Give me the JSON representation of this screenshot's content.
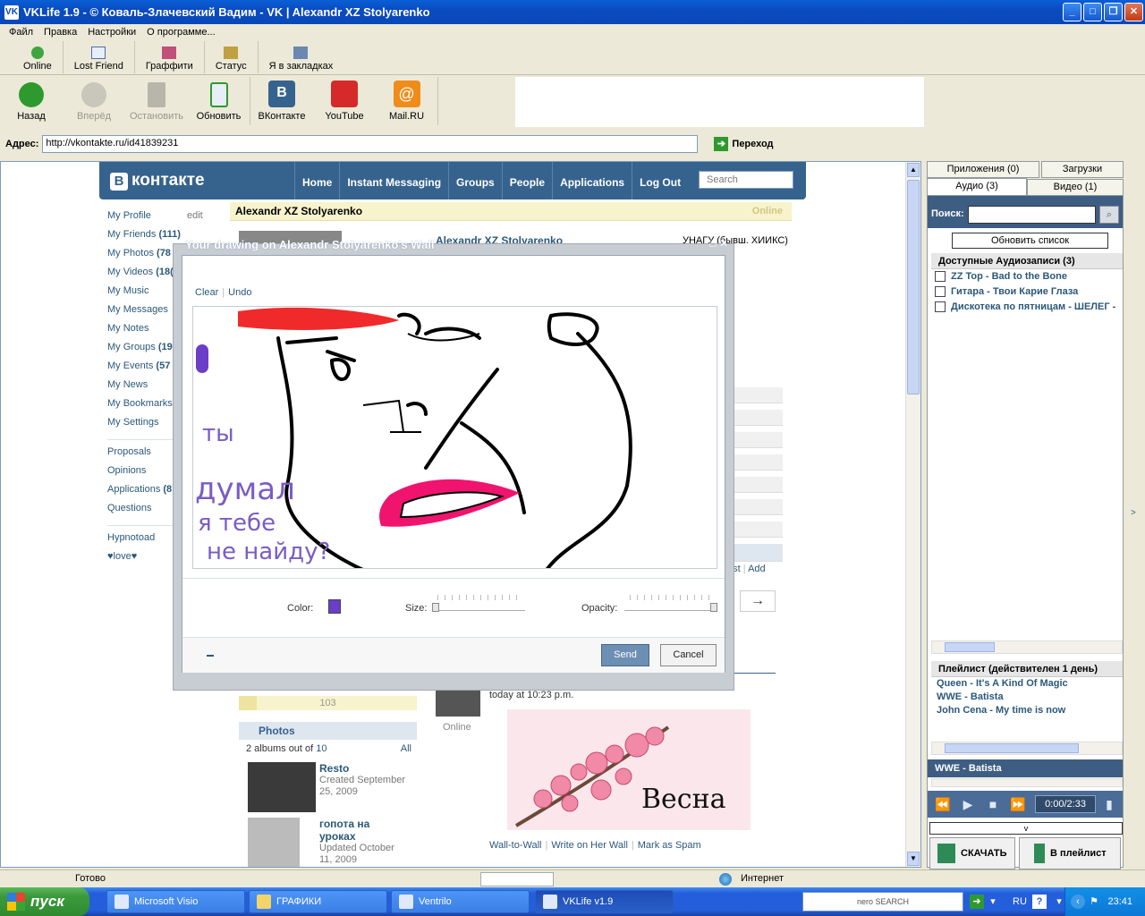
{
  "window": {
    "title": "VKLife 1.9 - © Коваль-Злачевский Вадим - VK | Alexandr XZ Stolyarenko",
    "app_icon": "vk-icon"
  },
  "menu": [
    "Файл",
    "Правка",
    "Настройки",
    "О программе..."
  ],
  "toolbar1": [
    {
      "label": "Online",
      "icon": "online-icon",
      "color": "#3fa63f"
    },
    {
      "label": "Lost Friend",
      "icon": "help-icon",
      "color": "#4c6fa8"
    },
    {
      "label": "Граффити",
      "icon": "paint-icon",
      "color": "#c0507a"
    },
    {
      "label": "Статус",
      "icon": "pencil-icon",
      "color": "#c0a040"
    },
    {
      "label": "Я в закладках",
      "icon": "bookmark-icon",
      "color": "#6a88b0"
    }
  ],
  "toolbar2": {
    "back": "Назад",
    "forward": "Вперёд",
    "stop": "Остановить",
    "refresh": "Обновить",
    "vk": "ВКонтакте",
    "youtube": "YouTube",
    "mail": "Mail.RU"
  },
  "address": {
    "label": "Адрес:",
    "url": "http://vkontakte.ru/id41839231",
    "go": "Переход"
  },
  "vk": {
    "logo": "контакте",
    "nav": [
      "Home",
      "Instant Messaging",
      "Groups",
      "People",
      "Applications",
      "Log Out"
    ],
    "search_placeholder": "Search",
    "menu": [
      {
        "t": "My Profile"
      },
      {
        "t": "My Friends",
        "c": "(111)"
      },
      {
        "t": "My Photos",
        "c": "(78"
      },
      {
        "t": "My Videos",
        "c": "(18("
      },
      {
        "t": "My Music"
      },
      {
        "t": "My Messages"
      },
      {
        "t": "My Notes"
      },
      {
        "t": "My Groups",
        "c": "(19"
      },
      {
        "t": "My Events",
        "c": "(57"
      },
      {
        "t": "My News"
      },
      {
        "t": "My Bookmarks"
      },
      {
        "t": "My Settings"
      }
    ],
    "edit": "edit",
    "menu2": [
      {
        "t": "Proposals"
      },
      {
        "t": "Opinions"
      },
      {
        "t": "Applications",
        "c": "(8"
      },
      {
        "t": "Questions"
      }
    ],
    "menu3": [
      "Hypnotoad",
      "♥love♥"
    ],
    "profile_name": "Alexandr XZ Stolyarenko",
    "status": "Online",
    "profile_link": "Alexandr XZ Stolyarenko",
    "university": "УНАГУ (бывш. ХИИКС)",
    "post_links": {
      "post": "ost",
      "add": "Add"
    },
    "pager_arrow": "→",
    "progress": {
      "value": "103",
      "fraction": 0.1
    },
    "photos": {
      "header": "Photos",
      "info": "2 albums out of",
      "count": "10",
      "all": "All",
      "albums": [
        {
          "name": "Resto",
          "desc": "Created September 25, 2009"
        },
        {
          "name": "гопота на уроках",
          "desc": "Updated October 11, 2009"
        }
      ]
    },
    "wall": {
      "time": "today at 10:23 p.m.",
      "online": "Online",
      "image_text": "Весна",
      "links": [
        "Wall-to-Wall",
        "Write on Her Wall",
        "Mark as Spam"
      ]
    }
  },
  "dialog": {
    "title": "Your drawing on Alexandr Stolyarenko's Wall",
    "clear": "Clear",
    "undo": "Undo",
    "canvas_text": [
      "ты",
      "думал",
      "я тебе",
      "не найду?"
    ],
    "color_label": "Color:",
    "color": "#6a3ec7",
    "size_label": "Size:",
    "size": 0,
    "opacity_label": "Opacity:",
    "opacity": 1,
    "send": "Send",
    "cancel": "Cancel"
  },
  "right": {
    "tabs_top": [
      "Приложения (0)",
      "Загрузки"
    ],
    "tabs": [
      "Аудио (3)",
      "Видео (1)"
    ],
    "search_label": "Поиск:",
    "refresh": "Обновить список",
    "audio_header": "Доступные Аудиозаписи (3)",
    "audio": [
      "ZZ Top  - Bad to the Bone",
      "Гитара  - Твои Карие Глаза",
      "Дискотека по пятницам - ШЕЛЕГ - :"
    ],
    "playlist_header": "Плейлист (действителен 1 день)",
    "playlist": [
      "Queen  - It's A Kind Of Magic",
      "WWE - Batista",
      "John Cena - My time is now"
    ],
    "now_playing": "WWE - Batista",
    "time": "0:00/2:33",
    "expand": "v",
    "download": "СКАЧАТЬ",
    "to_playlist": "В плейлист"
  },
  "statusbar": {
    "text": "Готово",
    "zone": "Интернет"
  },
  "taskbar": {
    "start": "пуск",
    "tasks": [
      "Microsoft Visio",
      "ГРАФИКИ",
      "Ventrilo",
      "VKLife v1.9"
    ],
    "search": "nero SEARCH",
    "lang": "RU",
    "time": "23:41"
  }
}
